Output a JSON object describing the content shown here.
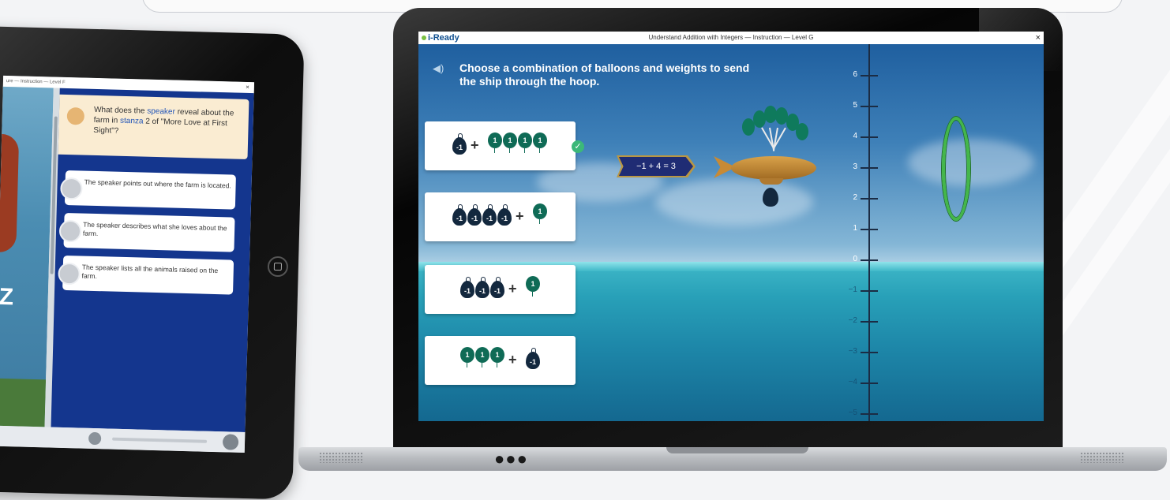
{
  "tablet": {
    "window_title": "ure — Instruction — Level F",
    "close": "×",
    "question_parts": [
      "What does the ",
      "speaker",
      " reveal about the farm in ",
      "stanza",
      " 2 of \"More Love at First Sight\"?"
    ],
    "answers": [
      "The speaker points out where the farm is located.",
      "The speaker describes what she loves about the farm.",
      "The speaker lists all the animals raised on the farm."
    ],
    "sidebar_letter": "Z"
  },
  "laptop": {
    "app_name": "i-Ready",
    "window_title": "Understand Addition with Integers — Instruction — Level G",
    "close": "×",
    "question": "Choose a combination of balloons and weights to send the ship through the hoop.",
    "plus": "+",
    "cards": [
      {
        "weights": [
          "-1"
        ],
        "balloons": [
          "1",
          "1",
          "1",
          "1"
        ],
        "order": "weights-first",
        "selected": true
      },
      {
        "weights": [
          "-1",
          "-1",
          "-1",
          "-1"
        ],
        "balloons": [
          "1"
        ],
        "order": "weights-first",
        "selected": false
      },
      {
        "weights": [
          "-1",
          "-1",
          "-1"
        ],
        "balloons": [
          "1"
        ],
        "order": "weights-first",
        "selected": false
      },
      {
        "weights": [
          "-1"
        ],
        "balloons": [
          "1",
          "1",
          "1"
        ],
        "order": "balloons-first",
        "selected": false
      }
    ],
    "equation": "−1 + 4 = 3",
    "number_line": {
      "labels": [
        "6",
        "5",
        "4",
        "3",
        "2",
        "1",
        "0",
        "−1",
        "−2",
        "−3",
        "−4",
        "−5"
      ],
      "values": [
        6,
        5,
        4,
        3,
        2,
        1,
        0,
        -1,
        -2,
        -3,
        -4,
        -5
      ],
      "ship_level": 3,
      "hoop_level": 3
    },
    "check_icon": "✓",
    "dock_dots": "●●●"
  },
  "colors": {
    "question_text": "#ffffff",
    "balloon": "#0f6b56",
    "weight": "#13283e",
    "equation_bg": "#1f2c74",
    "hoop": "#44b74a",
    "tablet_answer_pane": "#14368e"
  }
}
